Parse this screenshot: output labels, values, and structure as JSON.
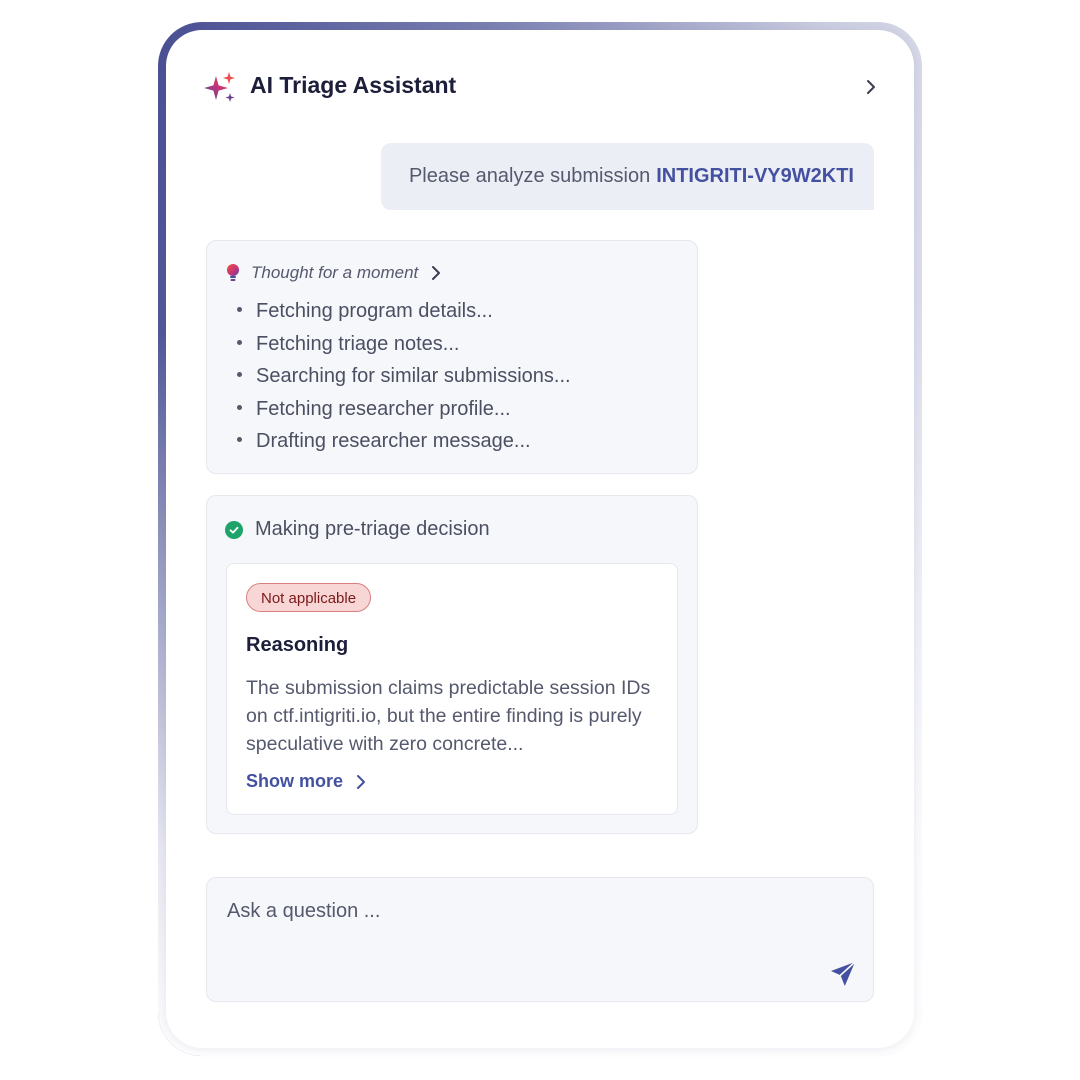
{
  "header": {
    "title": "AI Triage Assistant",
    "icon": "sparkle-icon",
    "expand_icon": "chevron-right-icon"
  },
  "user_message": {
    "text": "Please analyze submission",
    "submission_id": "INTIGRITI-VY9W2KTI"
  },
  "thought": {
    "label": "Thought for a moment",
    "icon": "lightbulb-icon",
    "steps": [
      "Fetching program details...",
      "Fetching triage notes...",
      "Searching for similar submissions...",
      "Fetching researcher profile...",
      "Drafting researcher message..."
    ]
  },
  "decision": {
    "label": "Making pre-triage decision",
    "status_icon": "check-circle-icon",
    "status_color": "#1fa36b",
    "badge": "Not applicable",
    "reasoning_title": "Reasoning",
    "reasoning_text": "The submission claims predictable session IDs on ctf.intigriti.io, but the entire finding is purely speculative with zero concrete...",
    "show_more": "Show more"
  },
  "input": {
    "placeholder": "Ask a question ...",
    "value": "",
    "send_icon": "send-icon"
  },
  "colors": {
    "accent": "#4451a0",
    "badge_bg": "#f8d6d6",
    "badge_text": "#7a1a1a"
  }
}
